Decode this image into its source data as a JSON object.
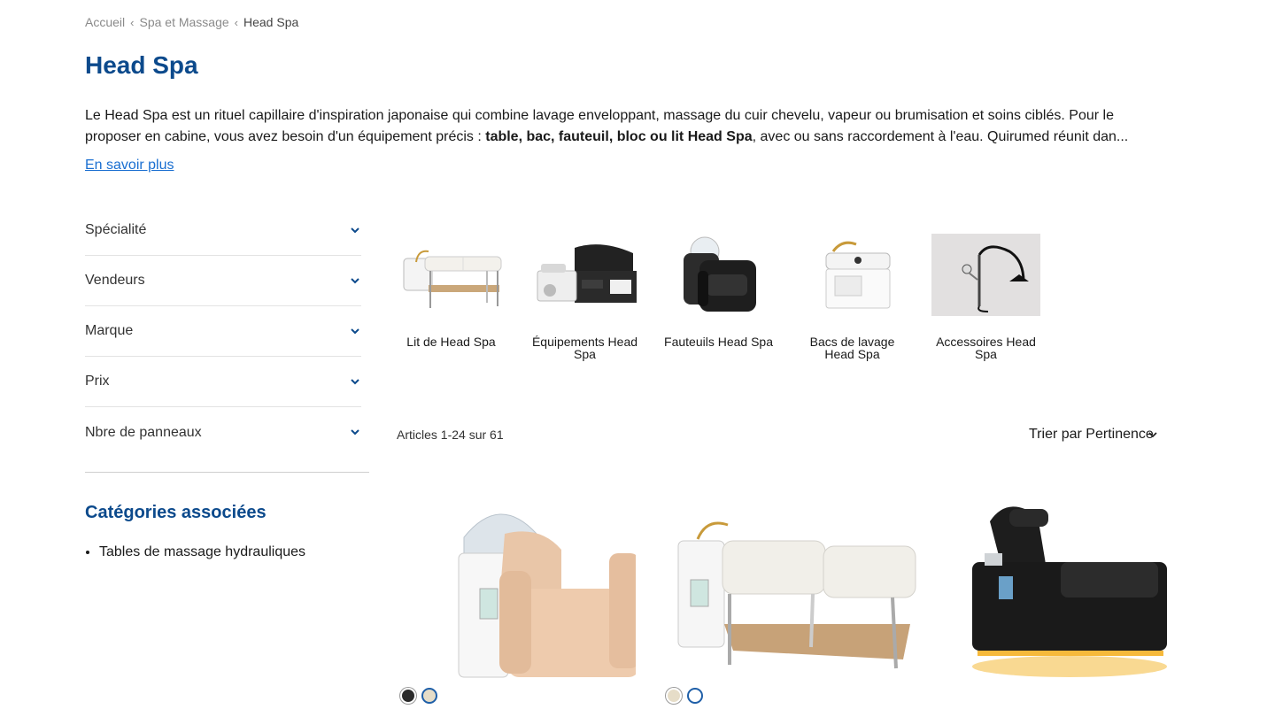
{
  "breadcrumb": {
    "items": [
      "Accueil",
      "Spa et Massage"
    ],
    "current": "Head Spa"
  },
  "page_title": "Head Spa",
  "intro": {
    "line1": "Le Head Spa est un rituel capillaire d'inspiration japonaise qui combine lavage enveloppant, massage du cuir chevelu, vapeur ou brumisation et soins ciblés. Pour le",
    "line2_start": "proposer en cabine, vous avez besoin d'un équipement précis : ",
    "line2_bold": "table, bac, fauteuil, bloc ou lit Head Spa",
    "line2_end": ", avec ou sans raccordement à l'eau. Quirumed réunit dan..."
  },
  "learn_more": "En savoir plus",
  "filters": [
    "Spécialité",
    "Vendeurs",
    "Marque",
    "Prix",
    "Nbre de panneaux"
  ],
  "associated": {
    "title": "Catégories associées",
    "items": [
      "Tables de massage hydrauliques"
    ]
  },
  "categories": [
    {
      "label": "Lit de Head Spa",
      "icon": "head-spa-bed-image"
    },
    {
      "label": "Équipements Head Spa",
      "icon": "head-spa-equipment-image"
    },
    {
      "label": "Fauteuils Head Spa",
      "icon": "head-spa-chair-image"
    },
    {
      "label": "Bacs de lavage Head Spa",
      "icon": "washing-basin-image"
    },
    {
      "label": "Accessoires Head Spa",
      "icon": "shower-accessory-image"
    }
  ],
  "results": {
    "count": "Articles 1-24 sur 61",
    "sort": "Trier par Pertinence"
  },
  "products": [
    {
      "icon": "beige-head-spa-chair-image",
      "swatches": [
        "#2b2b2b",
        "#e6ddc8"
      ]
    },
    {
      "icon": "white-head-spa-bed-image",
      "swatches": [
        "#e6ddc8",
        "#ffffff"
      ]
    },
    {
      "icon": "black-head-spa-lounger-image",
      "swatches": []
    }
  ],
  "colors": {
    "brand": "#0c4a8c",
    "link": "#1a6fd1",
    "swatch_ring": "#1f5fa8"
  }
}
